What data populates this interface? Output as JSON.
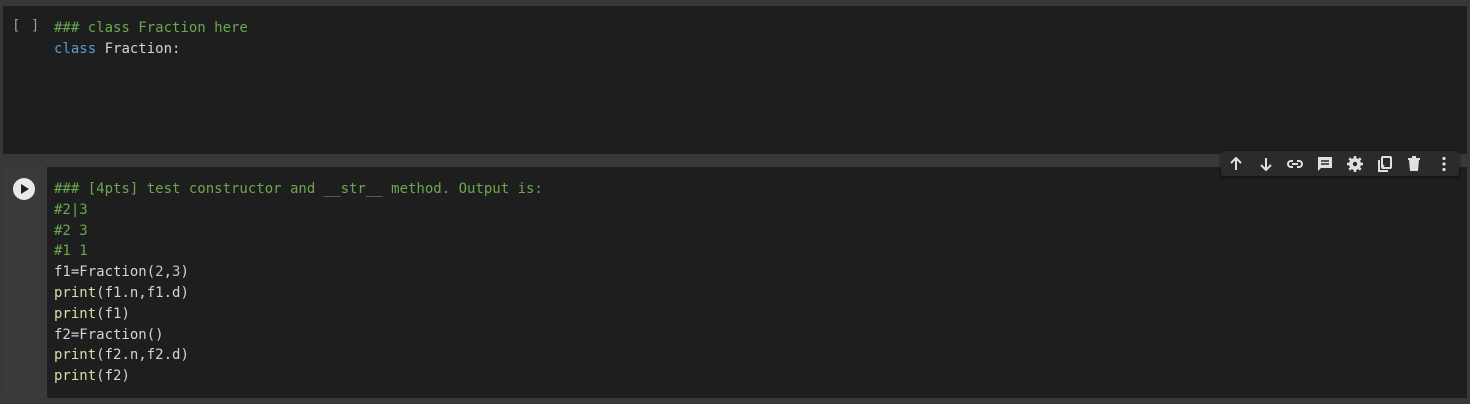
{
  "cell1": {
    "exec_count": "[ ]",
    "lines": [
      {
        "tokens": [
          {
            "t": "### class Fraction here",
            "c": "comment"
          }
        ]
      },
      {
        "tokens": [
          {
            "t": "class",
            "c": "kw"
          },
          {
            "t": " Fraction:",
            "c": ""
          }
        ]
      }
    ]
  },
  "cell2": {
    "lines": [
      {
        "tokens": [
          {
            "t": "### [4pts] test constructor and __str__ method. Output is:",
            "c": "comment"
          }
        ]
      },
      {
        "tokens": [
          {
            "t": "#2|3",
            "c": "comment"
          }
        ]
      },
      {
        "tokens": [
          {
            "t": "#2 3",
            "c": "comment"
          }
        ]
      },
      {
        "tokens": [
          {
            "t": "#1 1",
            "c": "comment"
          }
        ]
      },
      {
        "tokens": [
          {
            "t": "f1=Fraction(",
            "c": ""
          },
          {
            "t": "2",
            "c": "num"
          },
          {
            "t": ",",
            "c": ""
          },
          {
            "t": "3",
            "c": "num"
          },
          {
            "t": ")",
            "c": ""
          }
        ]
      },
      {
        "tokens": [
          {
            "t": "print",
            "c": "fn"
          },
          {
            "t": "(f1.n,f1.d)",
            "c": ""
          }
        ]
      },
      {
        "tokens": [
          {
            "t": "print",
            "c": "fn"
          },
          {
            "t": "(f1)",
            "c": ""
          }
        ]
      },
      {
        "tokens": [
          {
            "t": "f2=Fraction()",
            "c": ""
          }
        ]
      },
      {
        "tokens": [
          {
            "t": "print",
            "c": "fn"
          },
          {
            "t": "(f2.n,f2.d)",
            "c": ""
          }
        ]
      },
      {
        "tokens": [
          {
            "t": "print",
            "c": "fn"
          },
          {
            "t": "(f2)",
            "c": ""
          }
        ]
      }
    ]
  },
  "toolbar": {
    "icons": [
      "arrow-up-icon",
      "arrow-down-icon",
      "link-icon",
      "comment-icon",
      "gear-icon",
      "mirror-cell-icon",
      "trash-icon",
      "more-vert-icon"
    ]
  },
  "colors": {
    "background": "#383838",
    "cell_background": "#1e1e1e",
    "comment": "#6aa84f",
    "keyword": "#569cd6",
    "function": "#dcdcaa",
    "number": "#b5cea8",
    "text": "#d4d4d4"
  }
}
